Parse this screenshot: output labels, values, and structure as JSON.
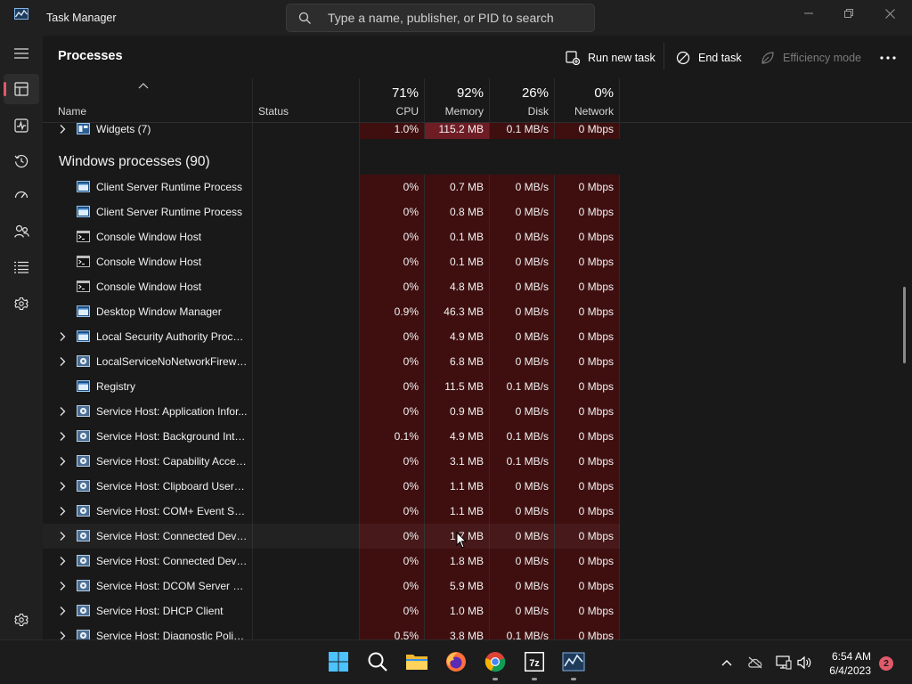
{
  "window": {
    "title": "Task Manager"
  },
  "search": {
    "placeholder": "Type a name, publisher, or PID to search"
  },
  "page": {
    "title": "Processes"
  },
  "commands": {
    "run_new_task": "Run new task",
    "end_task": "End task",
    "efficiency_mode": "Efficiency mode"
  },
  "columns": {
    "name": "Name",
    "status": "Status",
    "cpu": {
      "percent": "71%",
      "label": "CPU"
    },
    "memory": {
      "percent": "92%",
      "label": "Memory"
    },
    "disk": {
      "percent": "26%",
      "label": "Disk"
    },
    "network": {
      "percent": "0%",
      "label": "Network"
    }
  },
  "top_row": {
    "name": "Widgets (7)",
    "cpu": "1.0%",
    "memory": "115.2 MB",
    "disk": "0.1 MB/s",
    "network": "0 Mbps"
  },
  "group": {
    "title": "Windows processes (90)"
  },
  "processes": [
    {
      "name": "Client Server Runtime Process",
      "expandable": false,
      "icon": "window-app-icon",
      "cpu": "0%",
      "memory": "0.7 MB",
      "disk": "0 MB/s",
      "network": "0 Mbps"
    },
    {
      "name": "Client Server Runtime Process",
      "expandable": false,
      "icon": "window-app-icon",
      "cpu": "0%",
      "memory": "0.8 MB",
      "disk": "0 MB/s",
      "network": "0 Mbps"
    },
    {
      "name": "Console Window Host",
      "expandable": false,
      "icon": "console-icon",
      "cpu": "0%",
      "memory": "0.1 MB",
      "disk": "0 MB/s",
      "network": "0 Mbps"
    },
    {
      "name": "Console Window Host",
      "expandable": false,
      "icon": "console-icon",
      "cpu": "0%",
      "memory": "0.1 MB",
      "disk": "0 MB/s",
      "network": "0 Mbps"
    },
    {
      "name": "Console Window Host",
      "expandable": false,
      "icon": "console-icon",
      "cpu": "0%",
      "memory": "4.8 MB",
      "disk": "0 MB/s",
      "network": "0 Mbps"
    },
    {
      "name": "Desktop Window Manager",
      "expandable": false,
      "icon": "window-app-icon",
      "cpu": "0.9%",
      "memory": "46.3 MB",
      "disk": "0 MB/s",
      "network": "0 Mbps"
    },
    {
      "name": "Local Security Authority Proce...",
      "expandable": true,
      "icon": "window-app-icon",
      "cpu": "0%",
      "memory": "4.9 MB",
      "disk": "0 MB/s",
      "network": "0 Mbps"
    },
    {
      "name": "LocalServiceNoNetworkFirewa...",
      "expandable": true,
      "icon": "service-gear-icon",
      "cpu": "0%",
      "memory": "6.8 MB",
      "disk": "0 MB/s",
      "network": "0 Mbps"
    },
    {
      "name": "Registry",
      "expandable": false,
      "icon": "window-app-icon",
      "cpu": "0%",
      "memory": "11.5 MB",
      "disk": "0.1 MB/s",
      "network": "0 Mbps"
    },
    {
      "name": "Service Host: Application Infor...",
      "expandable": true,
      "icon": "service-gear-icon",
      "cpu": "0%",
      "memory": "0.9 MB",
      "disk": "0 MB/s",
      "network": "0 Mbps"
    },
    {
      "name": "Service Host: Background Inte...",
      "expandable": true,
      "icon": "service-gear-icon",
      "cpu": "0.1%",
      "memory": "4.9 MB",
      "disk": "0.1 MB/s",
      "network": "0 Mbps"
    },
    {
      "name": "Service Host: Capability Acces...",
      "expandable": true,
      "icon": "service-gear-icon",
      "cpu": "0%",
      "memory": "3.1 MB",
      "disk": "0.1 MB/s",
      "network": "0 Mbps"
    },
    {
      "name": "Service Host: Clipboard User S...",
      "expandable": true,
      "icon": "service-gear-icon",
      "cpu": "0%",
      "memory": "1.1 MB",
      "disk": "0 MB/s",
      "network": "0 Mbps"
    },
    {
      "name": "Service Host: COM+ Event Sys...",
      "expandable": true,
      "icon": "service-gear-icon",
      "cpu": "0%",
      "memory": "1.1 MB",
      "disk": "0 MB/s",
      "network": "0 Mbps"
    },
    {
      "name": "Service Host: Connected Devi...",
      "expandable": true,
      "icon": "service-gear-icon",
      "cpu": "0%",
      "memory": "1.7 MB",
      "disk": "0 MB/s",
      "network": "0 Mbps",
      "hovered": true
    },
    {
      "name": "Service Host: Connected Devi...",
      "expandable": true,
      "icon": "service-gear-icon",
      "cpu": "0%",
      "memory": "1.8 MB",
      "disk": "0 MB/s",
      "network": "0 Mbps"
    },
    {
      "name": "Service Host: DCOM Server Pr...",
      "expandable": true,
      "icon": "service-gear-icon",
      "cpu": "0%",
      "memory": "5.9 MB",
      "disk": "0 MB/s",
      "network": "0 Mbps"
    },
    {
      "name": "Service Host: DHCP Client",
      "expandable": true,
      "icon": "service-gear-icon",
      "cpu": "0%",
      "memory": "1.0 MB",
      "disk": "0 MB/s",
      "network": "0 Mbps"
    },
    {
      "name": "Service Host: Diagnostic Polic...",
      "expandable": true,
      "icon": "service-gear-icon",
      "cpu": "0.5%",
      "memory": "3.8 MB",
      "disk": "0.1 MB/s",
      "network": "0 Mbps"
    }
  ],
  "nav": [
    {
      "id": "menu",
      "icon": "hamburger-menu-icon"
    },
    {
      "id": "processes",
      "icon": "processes-icon",
      "active": true
    },
    {
      "id": "performance",
      "icon": "performance-icon"
    },
    {
      "id": "app-history",
      "icon": "app-history-icon"
    },
    {
      "id": "startup-apps",
      "icon": "startup-apps-icon"
    },
    {
      "id": "users",
      "icon": "users-icon"
    },
    {
      "id": "details",
      "icon": "details-icon"
    },
    {
      "id": "services",
      "icon": "services-icon"
    },
    {
      "id": "settings",
      "icon": "settings-gear-icon"
    }
  ],
  "taskbar": {
    "apps": [
      "start-windows-icon",
      "search-icon",
      "file-explorer-icon",
      "firefox-icon",
      "chrome-icon",
      "7zip-icon",
      "task-manager-icon"
    ],
    "tray": [
      "chevron-up-icon",
      "onedrive-off-icon",
      "display-icon",
      "volume-icon"
    ],
    "time": "6:54 AM",
    "date": "6/4/2023",
    "notification_count": "2"
  },
  "colors": {
    "accent": "#e05a6a",
    "heat_cell": "#3f0f10",
    "heat_high": "#6e1d25",
    "background": "#191919"
  }
}
